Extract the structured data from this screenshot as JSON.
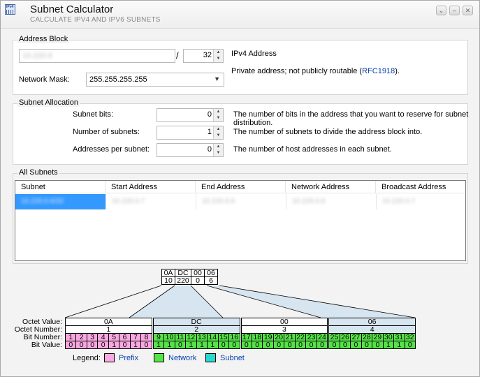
{
  "window": {
    "title": "Subnet Calculator",
    "subtitle": "CALCULATE IPV4 AND IPV6 SUBNETS",
    "app_icon_text": "IPv4",
    "buttons": [
      "⌄",
      "–",
      "✕"
    ]
  },
  "address_block": {
    "group_label": "Address Block",
    "address_value": "10.220.6",
    "slash": "/",
    "prefix_value": "32",
    "address_type": "IPv4 Address",
    "note_text": "Private address; not publicly routable (",
    "note_link": "RFC1918",
    "note_end": ").",
    "mask_label": "Network Mask:",
    "mask_value": "255.255.255.255"
  },
  "subnet_allocation": {
    "group_label": "Subnet Allocation",
    "rows": [
      {
        "label": "Subnet bits:",
        "value": "0",
        "help": "The number of bits in the address that you want to reserve for subnet",
        "help2": "distribution."
      },
      {
        "label": "Number of subnets:",
        "value": "1",
        "help": "The number of subnets to divide the address block into.",
        "help2": ""
      },
      {
        "label": "Addresses per subnet:",
        "value": "0",
        "help": "The number of host addresses in each subnet.",
        "help2": ""
      }
    ]
  },
  "all_subnets": {
    "group_label": "All Subnets",
    "columns": [
      "Subnet",
      "Start Address",
      "End Address",
      "Network Address",
      "Broadcast Address"
    ],
    "rows": [
      [
        "10.220.0.6/32",
        "10.220.0.7",
        "10.220.0.6",
        "10.220.0.6",
        "10.220.0.7"
      ]
    ]
  },
  "bit_view": {
    "top_hex": [
      "0A",
      "DC",
      "00",
      "06"
    ],
    "top_dec": [
      "10",
      "220",
      "0",
      "6"
    ],
    "row_labels": [
      "Octet Value:",
      "Octet Number:",
      "Bit Number:",
      "Bit Value:"
    ],
    "octets": [
      {
        "hex": "0A",
        "number": "1",
        "bits": [
          "1",
          "2",
          "3",
          "4",
          "5",
          "6",
          "7",
          "8"
        ],
        "values": [
          "0",
          "0",
          "0",
          "0",
          "1",
          "0",
          "1",
          "0"
        ]
      },
      {
        "hex": "DC",
        "number": "2",
        "bits": [
          "9",
          "10",
          "11",
          "12",
          "13",
          "14",
          "15",
          "16"
        ],
        "values": [
          "1",
          "1",
          "0",
          "1",
          "1",
          "1",
          "0",
          "0"
        ]
      },
      {
        "hex": "00",
        "number": "3",
        "bits": [
          "17",
          "18",
          "19",
          "20",
          "21",
          "22",
          "23",
          "24"
        ],
        "values": [
          "0",
          "0",
          "0",
          "0",
          "0",
          "0",
          "0",
          "0"
        ]
      },
      {
        "hex": "06",
        "number": "4",
        "bits": [
          "25",
          "26",
          "27",
          "28",
          "29",
          "30",
          "31",
          "32"
        ],
        "values": [
          "0",
          "0",
          "0",
          "0",
          "0",
          "1",
          "1",
          "0"
        ]
      }
    ],
    "legend_label": "Legend:",
    "legend": [
      {
        "name": "Prefix",
        "color": "#f9a9e1"
      },
      {
        "name": "Network",
        "color": "#57e24a"
      },
      {
        "name": "Subnet",
        "color": "#2cd6d0"
      }
    ]
  }
}
